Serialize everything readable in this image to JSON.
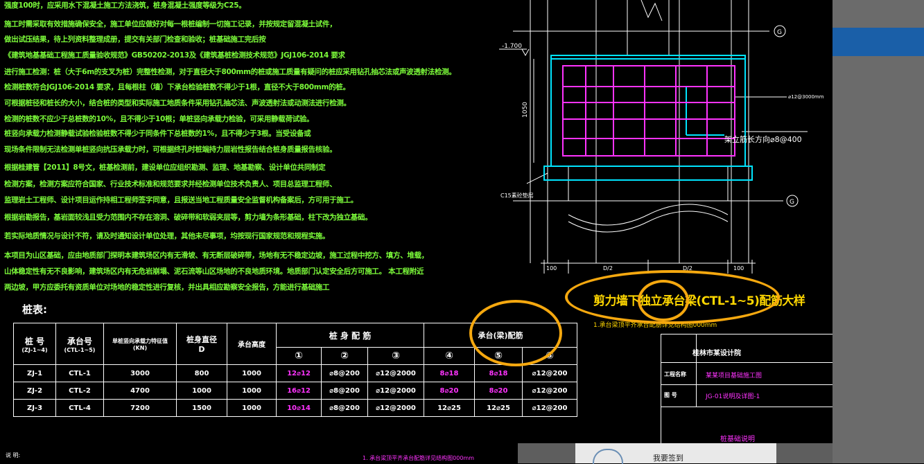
{
  "notes": [
    "强度100时，应采用水下混凝土施工方法浇筑，桩身混凝土强度等级为C25。",
    "施工时需采取有效措施确保安全，施工单位应做好对每一根桩编制一切施工记录，并按规定留混凝土试件，",
    "做出试压结果，待上列资料整理成册，提交有关部门检查和验收；桩基础施工完后按",
    "《建筑地基基础工程施工质量验收规范》GB50202-2013及《建筑基桩检测技术规范》JGJ106-2014 要求",
    "进行施工检测：桩（大于6m的支叉为桩）完整性检测，对于直径大于800mm的桩或施工质量有疑问的桩应采用钻孔抽芯法或声波透射法检测。",
    "检测桩数符合JGJ106-2014 要求，且每根柱（墙）下承台检验桩数不得少于1根，直径不大于800mm的桩。",
    "可根据桩径和桩长的大小，结合桩的类型和实际施工地质条件采用钻孔抽芯法、声波透射法或动测法进行检测。",
    "检测的桩数不应少于总桩数的10%，且不得少于10根；单桩竖向承载力检验，可采用静载荷试验。",
    "桩竖向承载力检测静载试验检验桩数不得少于同条件下总桩数的1%，且不得少于3根。当受设备或",
    "现场条件限制无法检测单桩竖向抗压承载力时，可根据终孔时桩端持力层岩性报告结合桩身质量报告核验。",
    "根据桂建管【2011】8号文，桩基检测前，建设单位应组织勘测、监理、地基勘察、设计单位共同制定",
    "检测方案，检测方案应符合国家、行业技术标准和规范要求并经检测单位技术负责人、项目总监理工程师、",
    "监理岩土工程师、设计项目运作持相工程师签字同意，且报送当地工程质量安全监督机构备案后，方可用于施工。",
    "根据岩勘报告，基岩面较浅且受力范围内不存在溶洞、破碎带和软弱夹层等，剪力墙为条形基础，柱下改为独立基础。",
    "若实际地质情况与设计不符，请及时通知设计单位处理，其他未尽事项，均按现行国家规范和规程实施。",
    "本项目为山区基础，应由地质部门探明本建筑场区内有无滑坡、有无断层破碎带，场地有无不稳定边坡，施工过程中挖方、填方、堆载，",
    "山体稳定性有无不良影响，建筑场区内有无危岩崩塌、泥石流等山区场地的不良地质环境。地质部门认定安全后方可施工。 本工程附近",
    "两边坡，甲方应委托有资质单位对场地的稳定性进行复核，并出具相应勘察安全报告，方能进行基础施工"
  ],
  "pile_table": {
    "title": "桩表:",
    "headers": {
      "pile_no": "桩 号",
      "pile_no_sub": "(ZJ-1~4)",
      "cap_no": "承台号",
      "cap_no_sub": "(CTL-1~5)",
      "capacity": "单桩竖向承载力特征值",
      "capacity_unit": "(KN)",
      "diameter": "桩身直径",
      "diameter_unit": "D",
      "cap_height": "承台高度",
      "body_rebar": "桩 身 配 筋",
      "cap_rebar": "承台(梁)配筋",
      "c1": "①",
      "c2": "②",
      "c3": "③",
      "c4": "④",
      "c5": "⑤",
      "c6": "⑤"
    },
    "rows": [
      {
        "pile": "ZJ-1",
        "cap": "CTL-1",
        "cap_force": "3000",
        "dia": "800",
        "height": "1000",
        "r1": "12⌀12",
        "r2": "⌀8@200",
        "r3": "⌀12@2000",
        "r4": "8⌀18",
        "r5": "8⌀18",
        "r6": "⌀12@200"
      },
      {
        "pile": "ZJ-2",
        "cap": "CTL-2",
        "cap_force": "4700",
        "dia": "1000",
        "height": "1000",
        "r1": "16⌀12",
        "r2": "⌀8@200",
        "r3": "⌀12@2000",
        "r4": "8⌀20",
        "r5": "8⌀20",
        "r6": "⌀12@200"
      },
      {
        "pile": "ZJ-3",
        "cap": "CTL-4",
        "cap_force": "7200",
        "dia": "1500",
        "height": "1000",
        "r1": "10⌀14",
        "r2": "⌀8@200",
        "r3": "⌀12@2000",
        "r4": "12⌀25",
        "r5": "12⌀25",
        "r6": "⌀12@200"
      }
    ]
  },
  "detail": {
    "title": "剪力墙下独立承台梁(CTL-1~5)配筋大样",
    "subtitle": "1.承台梁顶平齐承台配筋详见结构图000mm",
    "elevation": "-1.700",
    "height_dim": "1050",
    "rebar_note": "架立筋长方向⌀8@400",
    "small_note": "⌀12@3000mm",
    "cushion": "C15素砼垫层",
    "axis_top": "G",
    "axis_bottom": "G",
    "dim1": "100",
    "dim2": "100",
    "dim_d1": "D/2",
    "dim_d2": "D/2"
  },
  "title_block": {
    "company": "桂林市某设计院",
    "row1_label": "工程名称",
    "row1_value": "某某项目基础施工图",
    "row2_label": "图 号",
    "row2_value": "JG-01说明及详图-1",
    "drawing_name": "桩基础说明"
  },
  "bottom_strip": {
    "left": "说 明:",
    "right": "1. 承台梁顶平齐承台配筋详见结构图000mm"
  },
  "sidebar": {
    "signin_label": "我要签到"
  },
  "colors": {
    "accent_highlight": "#F5A80F",
    "note_green": "#7CFC3A",
    "rebar_magenta": "#FF33FF",
    "cad_cyan": "#00E5FF",
    "title_yellow": "#FFD700"
  }
}
